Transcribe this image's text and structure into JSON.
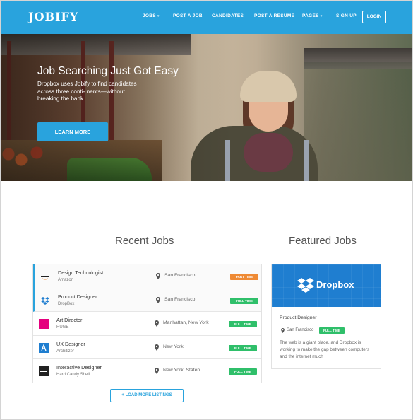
{
  "header": {
    "logo": "JOBIFY",
    "nav": [
      {
        "label": "JOBS",
        "dropdown": true
      },
      {
        "label": "POST A JOB",
        "dropdown": false
      },
      {
        "label": "CANDIDATES",
        "dropdown": false
      },
      {
        "label": "POST A RESUME",
        "dropdown": false
      },
      {
        "label": "PAGES",
        "dropdown": true
      },
      {
        "label": "SIGN UP",
        "dropdown": false
      }
    ],
    "login_label": "LOGIN",
    "caret": "▾"
  },
  "hero": {
    "title": "Job Searching Just Got Easy",
    "text": "Dropbox uses Jobify to find candidates across three conti- nents—without breaking the bank.",
    "cta": "LEARN MORE"
  },
  "recent": {
    "title": "Recent Jobs",
    "jobs": [
      {
        "title": "Design Technologist",
        "company": "Amazon",
        "location": "San Francisco",
        "type": "PART TIME",
        "type_color": "#ef8a34",
        "logo": "amazon-logo-icon"
      },
      {
        "title": "Product Designer",
        "company": "DropBox",
        "location": "San Francisco",
        "type": "FULL TIME",
        "type_color": "#2fbf6a",
        "logo": "dropbox-logo-icon"
      },
      {
        "title": "Art Director",
        "company": "HUGE",
        "location": "Manhattan, New York",
        "type": "FULL TIME",
        "type_color": "#2fbf6a",
        "logo": "huge-logo-icon"
      },
      {
        "title": "UX Designer",
        "company": "Architizer",
        "location": "New York",
        "type": "FULL TIME",
        "type_color": "#2fbf6a",
        "logo": "architizer-logo-icon"
      },
      {
        "title": "Interactive Designer",
        "company": "Hard Candy Shell",
        "location": "New York, Staten",
        "type": "FULL TIME",
        "type_color": "#2fbf6a",
        "logo": "hard-candy-shell-logo-icon"
      }
    ],
    "load_more": "+ LOAD MORE LISTINGS"
  },
  "featured": {
    "title": "Featured Jobs",
    "brand": "Dropbox",
    "role": "Product Designer",
    "location": "San Francisco",
    "type": "FULL TIME",
    "description": "The web is a giant place, and Dropbox is working to make the gap between computers and the internet much"
  },
  "colors": {
    "accent": "#29a3dd",
    "full_time": "#2fbf6a",
    "part_time": "#ef8a34",
    "huge": "#e5007e"
  }
}
